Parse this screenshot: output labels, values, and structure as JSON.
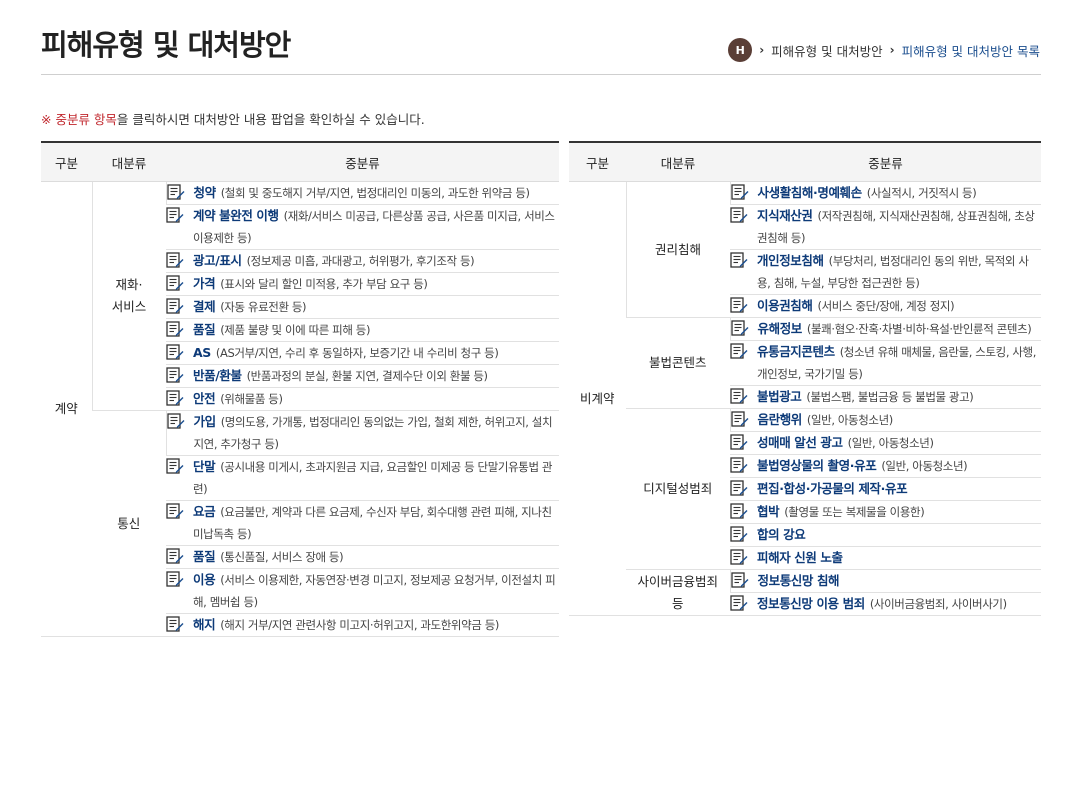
{
  "page": {
    "title": "피해유형 및 대처방안",
    "breadcrumb": {
      "home": "H",
      "parent": "피해유형 및 대처방안",
      "current": "피해유형 및 대처방안 목록"
    },
    "notice": {
      "highlight": "※ 중분류 항목",
      "rest": "을 클릭하시면 대처방안 내용 팝업을 확인하실 수 있습니다."
    }
  },
  "headers": {
    "col1": "구분",
    "col2": "대분류",
    "col3": "중분류"
  },
  "left": {
    "division": "계약",
    "groups": [
      {
        "label": "재화·\n서비스",
        "items": [
          {
            "name": "청약",
            "desc": "(철회 및 중도해지 거부/지연, 법정대리인 미동의, 과도한 위약금 등)"
          },
          {
            "name": "계약 불완전 이행",
            "desc": "(재화/서비스 미공급, 다른상품 공급, 사은품 미지급, 서비스 이용제한 등)"
          },
          {
            "name": "광고/표시",
            "desc": "(정보제공 미흡, 과대광고, 허위평가, 후기조작 등)"
          },
          {
            "name": "가격",
            "desc": "(표시와 달리 할인 미적용, 추가 부담 요구 등)"
          },
          {
            "name": "결제",
            "desc": "(자동 유료전환 등)"
          },
          {
            "name": "품질",
            "desc": "(제품 불량 및 이에 따른 피해 등)"
          },
          {
            "name": "AS",
            "desc": "(AS거부/지연, 수리 후 동일하자, 보증기간 내 수리비 청구 등)"
          },
          {
            "name": "반품/환불",
            "desc": "(반품과정의 분실, 환불 지연, 결제수단 이외 환불 등)"
          },
          {
            "name": "안전",
            "desc": "(위해물품 등)"
          }
        ]
      },
      {
        "label": "통신",
        "items": [
          {
            "name": "가입",
            "desc": "(명의도용, 가개통, 법정대리인 동의없는 가입, 철회 제한, 허위고지, 설치지연, 추가청구 등)"
          },
          {
            "name": "단말",
            "desc": "(공시내용 미게시, 초과지원금 지급, 요금할인 미제공 등 단말기유통법 관련)"
          },
          {
            "name": "요금",
            "desc": "(요금불만, 계약과 다른 요금제, 수신자 부담, 회수대행 관련 피해, 지나친 미납독촉 등)"
          },
          {
            "name": "품질",
            "desc": "(통신품질, 서비스 장애 등)"
          },
          {
            "name": "이용",
            "desc": "(서비스 이용제한, 자동연장·변경 미고지, 정보제공 요청거부, 이전설치 피해, 멤버쉽 등)"
          },
          {
            "name": "해지",
            "desc": "(해지 거부/지연 관련사항 미고지·허위고지, 과도한위약금 등)"
          }
        ]
      }
    ]
  },
  "right": {
    "division": "비계약",
    "groups": [
      {
        "label": "권리침해",
        "items": [
          {
            "name": "사생활침해·명예훼손",
            "desc": "(사실적시, 거짓적시 등)"
          },
          {
            "name": "지식재산권",
            "desc": "(저작권침해, 지식재산권침해, 상표권침해, 초상권침해 등)"
          },
          {
            "name": "개인정보침해",
            "desc": "(부당처리, 법정대리인 동의 위반, 목적외 사용, 침해, 누설, 부당한 접근권한 등)"
          },
          {
            "name": "이용권침해",
            "desc": "(서비스 중단/장애, 계정 정지)"
          }
        ]
      },
      {
        "label": "불법콘텐츠",
        "items": [
          {
            "name": "유해정보",
            "desc": "(불쾌·혐오·잔혹·차별·비하·욕설·반인륜적 콘텐츠)"
          },
          {
            "name": "유통금지콘텐츠",
            "desc": "(청소년 유해 매체물, 음란물, 스토킹, 사행, 개인정보, 국가기밀 등)"
          },
          {
            "name": "불법광고",
            "desc": "(불법스팸, 불법금융 등 불법물 광고)"
          }
        ]
      },
      {
        "label": "디지털성범죄",
        "items": [
          {
            "name": "음란행위",
            "desc": "(일반, 아동청소년)"
          },
          {
            "name": "성매매 알선 광고",
            "desc": "(일반, 아동청소년)"
          },
          {
            "name": "불법영상물의 촬영·유포",
            "desc": "(일반, 아동청소년)"
          },
          {
            "name": "편집·합성·가공물의 제작·유포",
            "desc": ""
          },
          {
            "name": "협박",
            "desc": "(촬영물 또는 복제물을 이용한)"
          },
          {
            "name": "합의 강요",
            "desc": ""
          },
          {
            "name": "피해자 신원 노출",
            "desc": ""
          }
        ]
      },
      {
        "label": "사이버금융범죄\n등",
        "items": [
          {
            "name": "정보통신망 침해",
            "desc": ""
          },
          {
            "name": "정보통신망 이용 범죄",
            "desc": "(사이버금융범죄, 사이버사기)"
          }
        ]
      }
    ]
  }
}
